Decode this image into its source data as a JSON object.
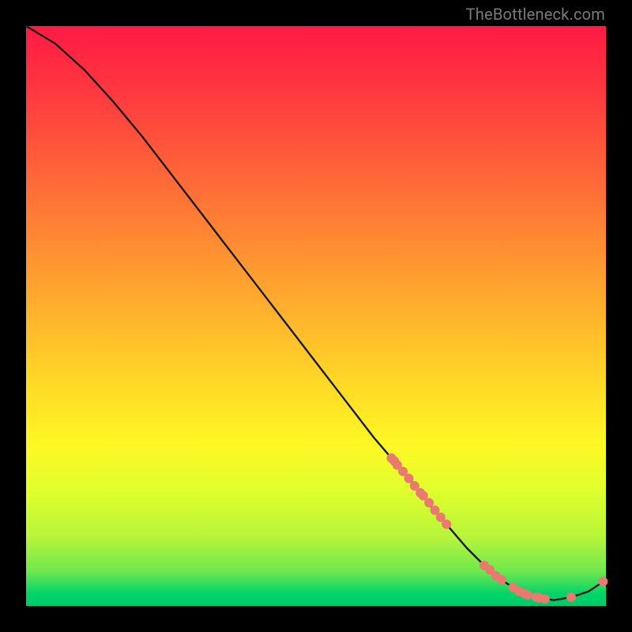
{
  "watermark": "TheBottleneck.com",
  "colors": {
    "background": "#000000",
    "curve": "#1a1a1a",
    "dot": "#e97a6e",
    "gradient_top": "#ff1a44",
    "gradient_bottom": "#00c86a"
  },
  "chart_data": {
    "type": "line",
    "title": "",
    "xlabel": "",
    "ylabel": "",
    "xlim": [
      0,
      100
    ],
    "ylim": [
      0,
      100
    ],
    "grid": false,
    "legend": false,
    "curve": {
      "x": [
        0,
        5,
        10,
        15,
        20,
        25,
        30,
        35,
        40,
        45,
        50,
        55,
        60,
        63,
        66,
        68,
        70,
        73,
        76,
        79,
        82,
        85,
        88,
        91,
        94,
        97,
        100
      ],
      "y": [
        100,
        97,
        92.5,
        87,
        81,
        74.5,
        68,
        61.5,
        55,
        48.5,
        42,
        35.5,
        29,
        25.5,
        22,
        19.5,
        17,
        13.5,
        10,
        7,
        4.5,
        2.5,
        1.5,
        1,
        1.5,
        2.5,
        4.5
      ]
    },
    "dots": [
      {
        "x": 63,
        "y": 25.5
      },
      {
        "x": 63.5,
        "y": 25
      },
      {
        "x": 64,
        "y": 24.3
      },
      {
        "x": 65,
        "y": 23.2
      },
      {
        "x": 66,
        "y": 22
      },
      {
        "x": 67,
        "y": 20.7
      },
      {
        "x": 68,
        "y": 19.5
      },
      {
        "x": 68.5,
        "y": 19
      },
      {
        "x": 69.5,
        "y": 17.8
      },
      {
        "x": 70.5,
        "y": 16.5
      },
      {
        "x": 71.5,
        "y": 15.3
      },
      {
        "x": 72.5,
        "y": 14.1
      },
      {
        "x": 79,
        "y": 7
      },
      {
        "x": 80,
        "y": 6.2
      },
      {
        "x": 81,
        "y": 5.2
      },
      {
        "x": 82,
        "y": 4.5
      },
      {
        "x": 84,
        "y": 3.2
      },
      {
        "x": 85,
        "y": 2.5
      },
      {
        "x": 86,
        "y": 2.1
      },
      {
        "x": 86.5,
        "y": 1.9
      },
      {
        "x": 88,
        "y": 1.5
      },
      {
        "x": 88.5,
        "y": 1.4
      },
      {
        "x": 89.5,
        "y": 1.2
      },
      {
        "x": 94,
        "y": 1.5
      },
      {
        "x": 99.5,
        "y": 4.2
      }
    ]
  }
}
